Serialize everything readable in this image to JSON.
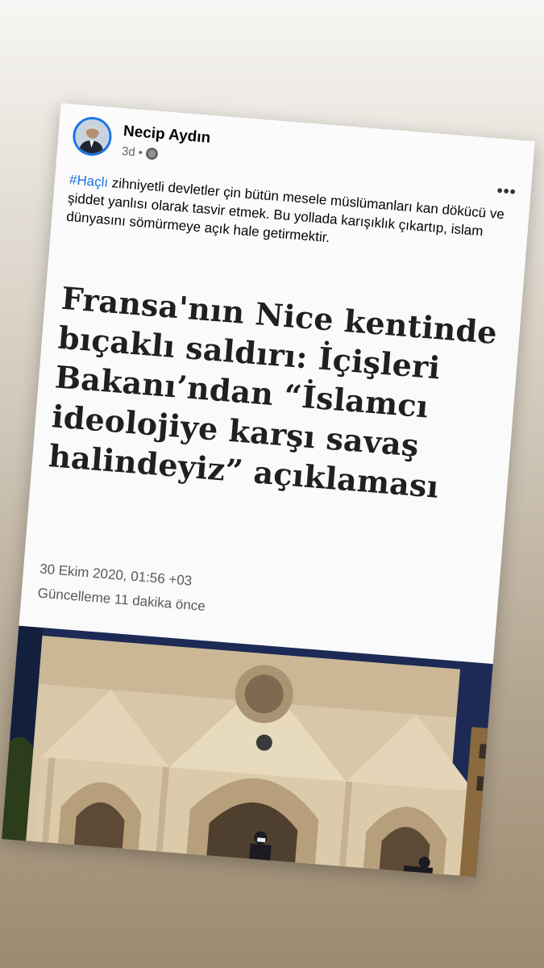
{
  "post": {
    "author_name": "Necip Aydın",
    "time": "3d",
    "separator": "•",
    "privacy_icon": "globe-icon",
    "more_label": "•••",
    "hashtag": "#Haçlı",
    "text_after_hashtag": " zihniyetli devletler çin bütün mesele müslümanları kan dökücü ve şiddet yanlısı olarak tasvir etmek. Bu yollada karışıklık çıkartıp, islam dünyasını sömürmeye açık hale getirmektir."
  },
  "article": {
    "headline": "Fransa'nın Nice kentinde bıçaklı saldırı: İçişleri Bakanı’ndan “İslamcı ideolojiye karşı savaş halindeyiz” açıklaması",
    "date": "30 Ekim 2020, 01:56 +03",
    "updated": "Güncelleme 11 dakika önce"
  },
  "colors": {
    "link": "#1b74e4",
    "meta_gray": "#65676b",
    "headline": "#202020"
  }
}
